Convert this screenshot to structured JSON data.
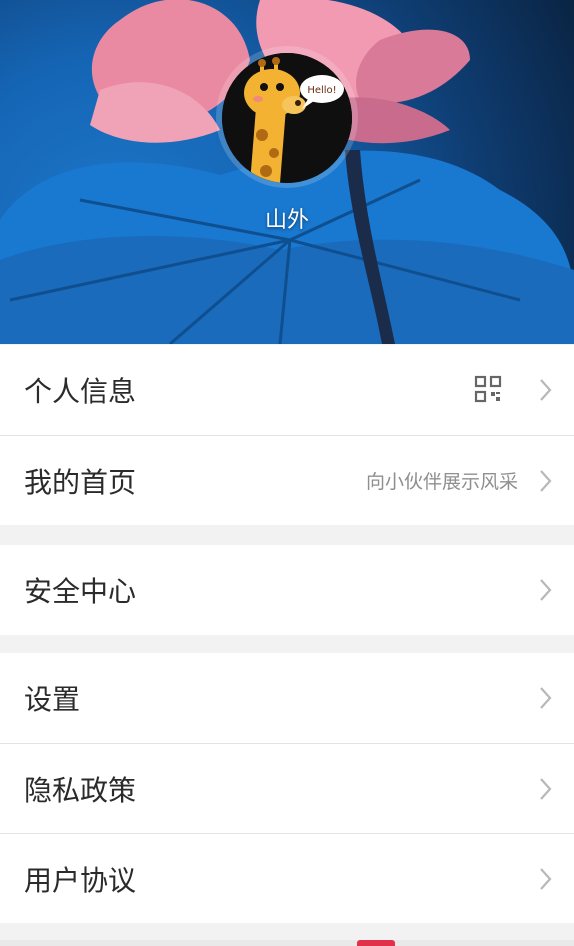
{
  "profile": {
    "username": "山外",
    "avatar_bubble": "Hello!"
  },
  "menu": {
    "personal_info": "个人信息",
    "my_homepage": "我的首页",
    "my_homepage_sub": "向小伙伴展示风采",
    "security_center": "安全中心",
    "settings": "设置",
    "privacy_policy": "隐私政策",
    "user_agreement": "用户协议"
  },
  "icons": {
    "qr": "qr-code-icon",
    "chevron": "chevron-right-icon"
  },
  "colors": {
    "row_text": "#2b2b2b",
    "sub_text": "#8f8f8f",
    "divider": "#e3e3e3",
    "background": "#f2f2f2"
  }
}
